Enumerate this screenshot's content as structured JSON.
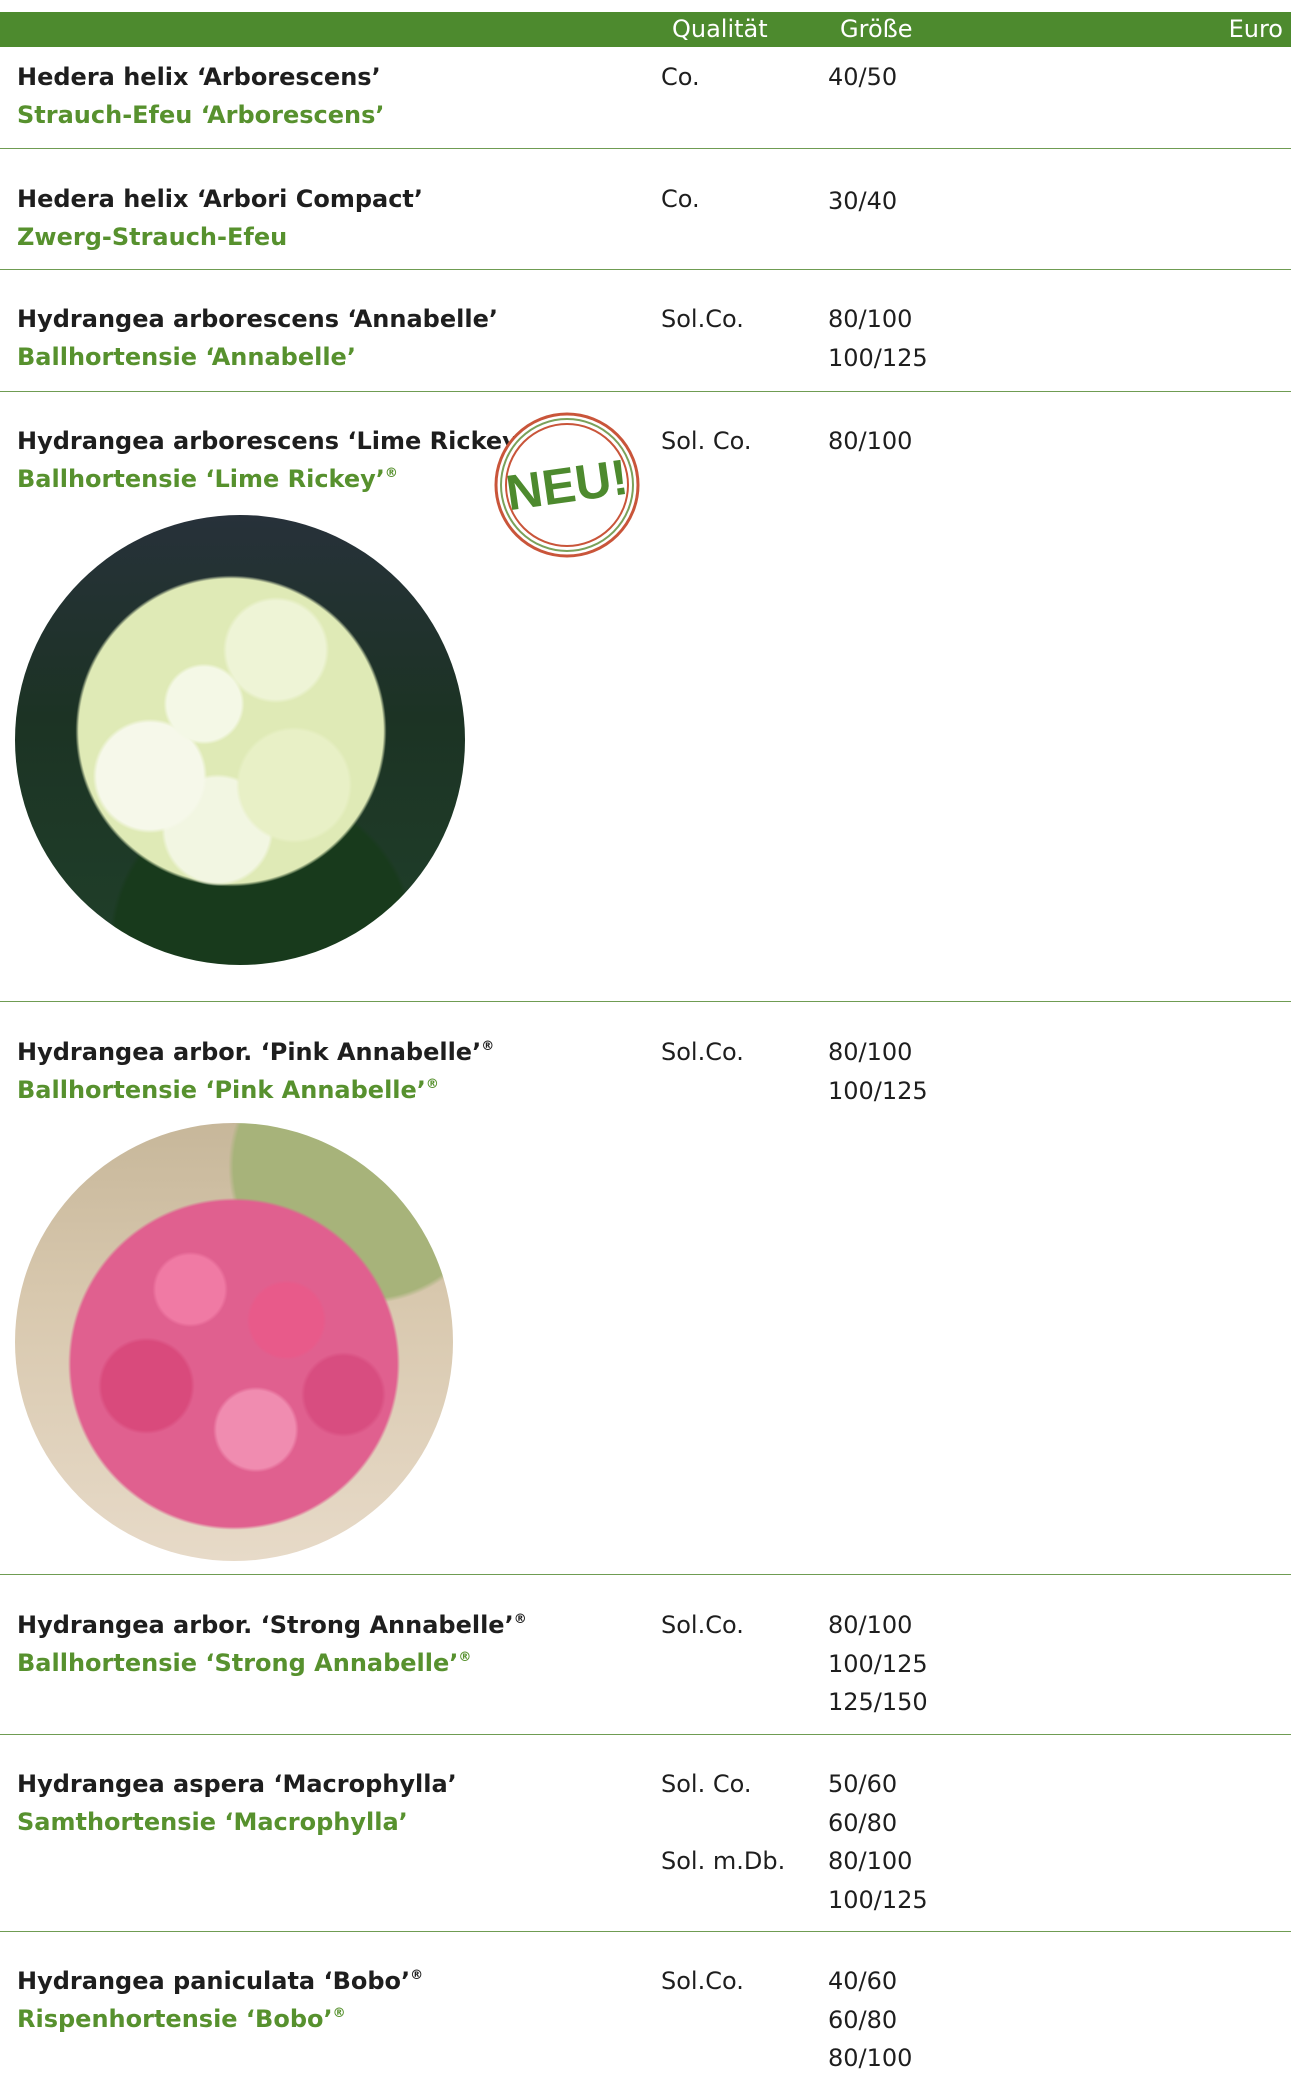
{
  "header": {
    "quality": "Qualität",
    "size": "Größe",
    "price": "Euro"
  },
  "colors": {
    "header_bg": "#4d8a2e",
    "common_name": "#57912e",
    "rule": "#6f9c52",
    "badge": "#c9553a"
  },
  "badge": {
    "label": "NEU!"
  },
  "entries": [
    {
      "botanical": "Hedera helix ‘Arborescens’",
      "common": "Strauch-Efeu ‘Arborescens’",
      "quality": [
        "Co."
      ],
      "sizes": [
        "40/50"
      ]
    },
    {
      "botanical": "Hedera helix ‘Arbori Compact’",
      "common": "Zwerg-Strauch-Efeu",
      "quality": [
        "Co."
      ],
      "sizes": [
        "30/40"
      ]
    },
    {
      "botanical": "Hydrangea arborescens ‘Annabelle’",
      "common": "Ballhortensie ‘Annabelle’",
      "quality": [
        "Sol.Co."
      ],
      "sizes": [
        "80/100",
        "100/125"
      ]
    },
    {
      "botanical": "Hydrangea arborescens ‘Lime Rickey’",
      "common": "Ballhortensie ‘Lime Rickey’",
      "registered": "®",
      "quality": [
        "Sol. Co."
      ],
      "sizes": [
        "80/100"
      ],
      "photo": "white-hydrangea-photo"
    },
    {
      "botanical": "Hydrangea arbor. ‘Pink Annabelle’",
      "common": "Ballhortensie ‘Pink Annabelle’",
      "registered": "®",
      "quality": [
        "Sol.Co."
      ],
      "sizes": [
        "80/100",
        "100/125"
      ],
      "photo": "pink-hydrangea-photo"
    },
    {
      "botanical": "Hydrangea arbor. ‘Strong Annabelle’",
      "common": "Ballhortensie ‘Strong Annabelle’",
      "registered": "®",
      "quality": [
        "Sol.Co."
      ],
      "sizes": [
        "80/100",
        "100/125",
        "125/150"
      ]
    },
    {
      "botanical": "Hydrangea aspera ‘Macrophylla’",
      "common": "Samthortensie ‘Macrophylla’",
      "quality": [
        "Sol. Co.",
        "Sol. m.Db."
      ],
      "sizes": [
        "50/60",
        "60/80",
        "80/100",
        "100/125"
      ]
    },
    {
      "botanical": "Hydrangea paniculata ‘Bobo’",
      "common": "Rispenhortensie ‘Bobo’",
      "registered": "®",
      "quality": [
        "Sol.Co."
      ],
      "sizes": [
        "40/60",
        "60/80",
        "80/100"
      ]
    }
  ]
}
